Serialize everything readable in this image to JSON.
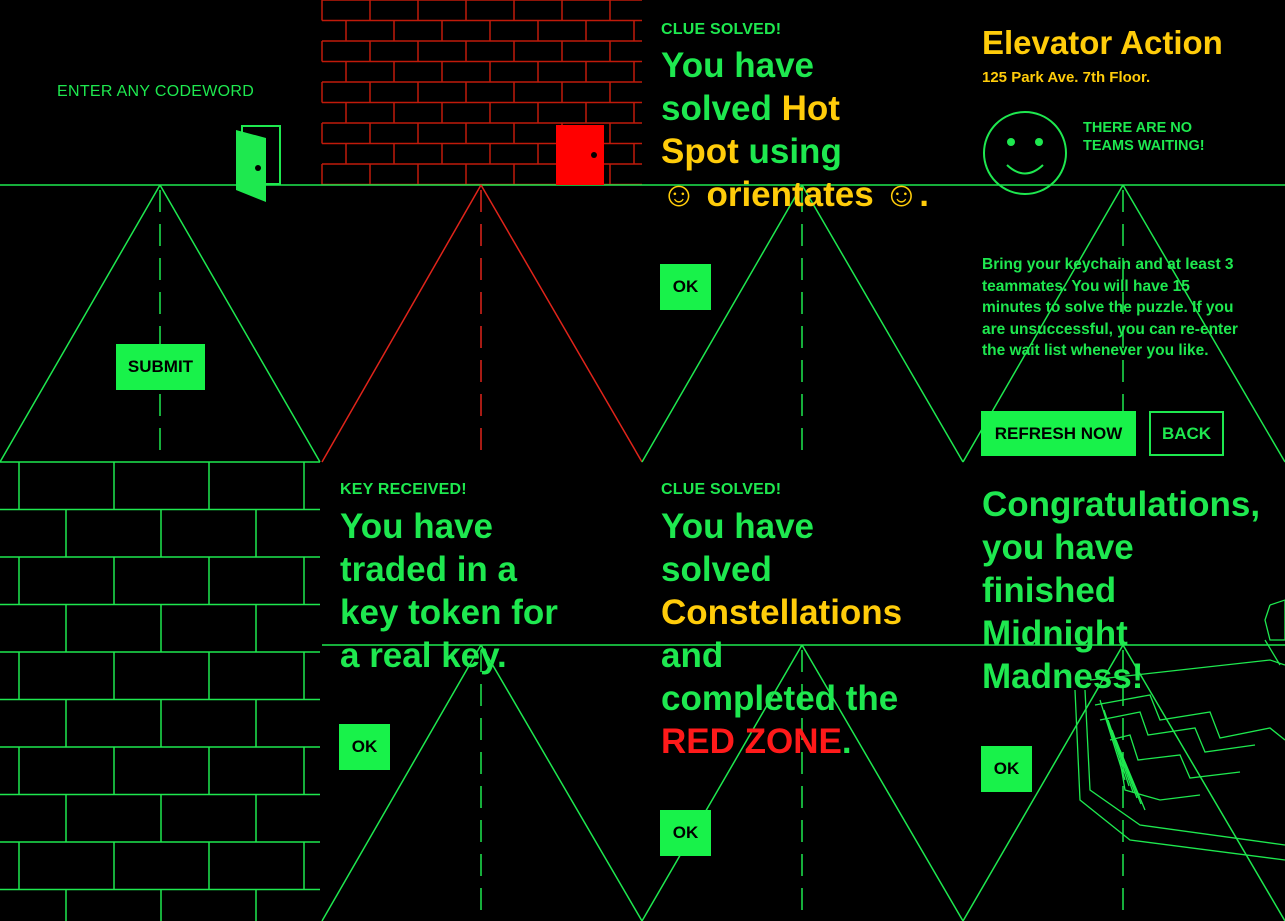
{
  "colors": {
    "background": "#000000",
    "green": "#1ee84f",
    "button_green": "#18f24a",
    "yellow": "#ffcc0a",
    "red": "#ff1a1a",
    "brick_red": "#c01a0a"
  },
  "panel_codeword": {
    "prompt": "ENTER ANY CODEWORD",
    "submit_label": "SUBMIT",
    "door_icon": "open-door-icon"
  },
  "panel_redwall": {
    "door_icon": "red-door-icon"
  },
  "panel_clue_hotspot": {
    "heading": "CLUE SOLVED!",
    "line1": "You have",
    "line2_a": "solved ",
    "line2_b": "Hot",
    "line3_a": "Spot",
    "line3_b": " using",
    "line4_a": "☺ orientates ☺",
    "line4_b": ".",
    "ok_label": "OK"
  },
  "panel_elevator": {
    "title": "Elevator Action",
    "address": "125 Park Ave. 7th Floor.",
    "smiley_icon": "smiley-face-icon",
    "wait_line1": "THERE ARE NO",
    "wait_line2": "TEAMS WAITING!",
    "instructions_lines": [
      "Bring your keychain and at least 3",
      "teammates. You will have 15",
      "minutes to solve the puzzle. If you",
      "are unsuccessful, you can re-enter",
      "the wait list whenever you like."
    ],
    "refresh_label": "REFRESH NOW",
    "back_label": "BACK"
  },
  "panel_key": {
    "heading": "KEY RECEIVED!",
    "lines": [
      "You have",
      "traded in a",
      "key token for",
      "a real key."
    ],
    "ok_label": "OK"
  },
  "panel_clue_constellations": {
    "heading": "CLUE SOLVED!",
    "line1": "You have",
    "line2": "solved",
    "line3": "Constellations",
    "line4": "and",
    "line5": "completed the",
    "line6_a": "RED ZONE",
    "line6_b": ".",
    "ok_label": "OK"
  },
  "panel_congrats": {
    "lines": [
      "Congratulations,",
      "you have",
      "finished",
      "Midnight",
      "Madness!"
    ],
    "ok_label": "OK"
  }
}
